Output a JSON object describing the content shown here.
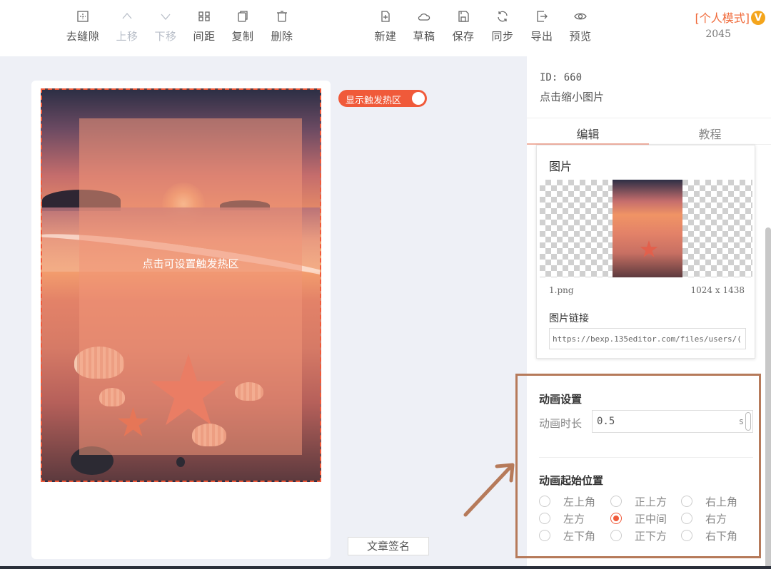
{
  "toolbar": {
    "tools": [
      {
        "label": "去缝隙",
        "icon": "grid-icon"
      },
      {
        "label": "上移",
        "icon": "chevron-up-icon"
      },
      {
        "label": "下移",
        "icon": "chevron-down-icon"
      },
      {
        "label": "间距",
        "icon": "spacing-icon"
      },
      {
        "label": "复制",
        "icon": "copy-icon"
      },
      {
        "label": "删除",
        "icon": "trash-icon"
      },
      {
        "label": "新建",
        "icon": "new-file-icon"
      },
      {
        "label": "草稿",
        "icon": "cloud-icon"
      },
      {
        "label": "保存",
        "icon": "save-icon"
      },
      {
        "label": "同步",
        "icon": "sync-icon"
      },
      {
        "label": "导出",
        "icon": "export-icon"
      },
      {
        "label": "预览",
        "icon": "eye-icon"
      }
    ],
    "mode_label": "[个人模式]",
    "vip_badge": "V",
    "mode_count": "2045"
  },
  "canvas": {
    "hotzone_toggle_label": "显示触发热区",
    "hotzone_label": "点击可设置触发热区",
    "signature_button": "文章签名"
  },
  "panel": {
    "id_text": "ID: 660",
    "subtitle": "点击缩小图片",
    "tabs": [
      {
        "label": "编辑",
        "active": true
      },
      {
        "label": "教程",
        "active": false
      }
    ],
    "image": {
      "title": "图片",
      "filename": "1.png",
      "dimensions": "1024 x 1438",
      "link_label": "图片链接",
      "link_value": "https://bexp.135editor.com/files/users/("
    },
    "animation": {
      "title": "动画设置",
      "duration_label": "动画时长",
      "duration_value": "0.5",
      "duration_unit": "s",
      "position_title": "动画起始位置",
      "positions": [
        [
          "左上角",
          "正上方",
          "右上角"
        ],
        [
          "左方",
          "正中间",
          "右方"
        ],
        [
          "左下角",
          "正下方",
          "右下角"
        ]
      ],
      "selected_position": "正中间"
    }
  },
  "colors": {
    "accent": "#f05a3a",
    "highlight_box": "#b67a5a",
    "vip": "#f4a51c"
  }
}
